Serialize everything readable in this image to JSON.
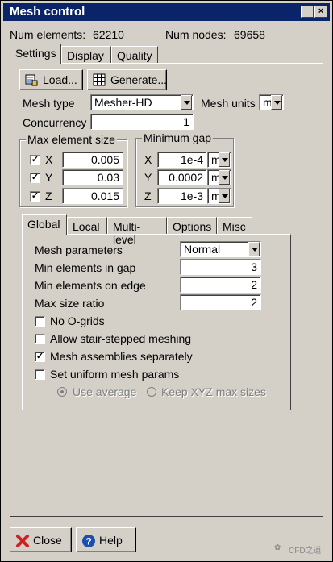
{
  "window": {
    "title": "Mesh control",
    "minimize_glyph": "_",
    "close_glyph": "×"
  },
  "stats": {
    "elements_label": "Num elements:",
    "elements_value": "62210",
    "nodes_label": "Num nodes:",
    "nodes_value": "69658"
  },
  "tabs": {
    "settings": "Settings",
    "display": "Display",
    "quality": "Quality"
  },
  "buttons": {
    "load": "Load...",
    "generate": "Generate..."
  },
  "mesh_type": {
    "label": "Mesh type",
    "value": "Mesher-HD"
  },
  "mesh_units": {
    "label": "Mesh units",
    "value": "m"
  },
  "concurrency": {
    "label": "Concurrency",
    "value": "1"
  },
  "max_element_size": {
    "title": "Max element size",
    "x": {
      "label": "X",
      "checked": true,
      "value": "0.005"
    },
    "y": {
      "label": "Y",
      "checked": true,
      "value": "0.03"
    },
    "z": {
      "label": "Z",
      "checked": true,
      "value": "0.015"
    }
  },
  "minimum_gap": {
    "title": "Minimum gap",
    "x": {
      "label": "X",
      "value": "1e-4",
      "unit": "m"
    },
    "y": {
      "label": "Y",
      "value": "0.0002",
      "unit": "m"
    },
    "z": {
      "label": "Z",
      "value": "1e-3",
      "unit": "m"
    }
  },
  "subtabs": {
    "global": "Global",
    "local": "Local",
    "multilevel": "Multi-level",
    "options": "Options",
    "misc": "Misc"
  },
  "global": {
    "mesh_parameters": {
      "label": "Mesh parameters",
      "value": "Normal"
    },
    "min_elements_gap": {
      "label": "Min elements in gap",
      "value": "3"
    },
    "min_elements_edge": {
      "label": "Min elements on edge",
      "value": "2"
    },
    "max_size_ratio": {
      "label": "Max size ratio",
      "value": "2"
    },
    "no_ogrids": {
      "label": "No O-grids",
      "checked": false
    },
    "stair_stepped": {
      "label": "Allow stair-stepped meshing",
      "checked": false
    },
    "assemblies_separately": {
      "label": "Mesh assemblies separately",
      "checked": true
    },
    "uniform_params": {
      "label": "Set uniform mesh params",
      "checked": false
    },
    "use_average": {
      "label": "Use average",
      "selected": true
    },
    "keep_xyz": {
      "label": "Keep XYZ max sizes",
      "selected": false
    }
  },
  "footer": {
    "close": "Close",
    "help": "Help",
    "watermark": "CFD之道"
  },
  "icons": {
    "load": "load-icon",
    "generate": "grid-icon",
    "close": "close-x-icon",
    "help": "help-icon"
  },
  "colors": {
    "titlebar": "#0a246a",
    "face": "#d4d0c8",
    "close_red": "#cc2222",
    "help_blue": "#1a4fb0"
  }
}
